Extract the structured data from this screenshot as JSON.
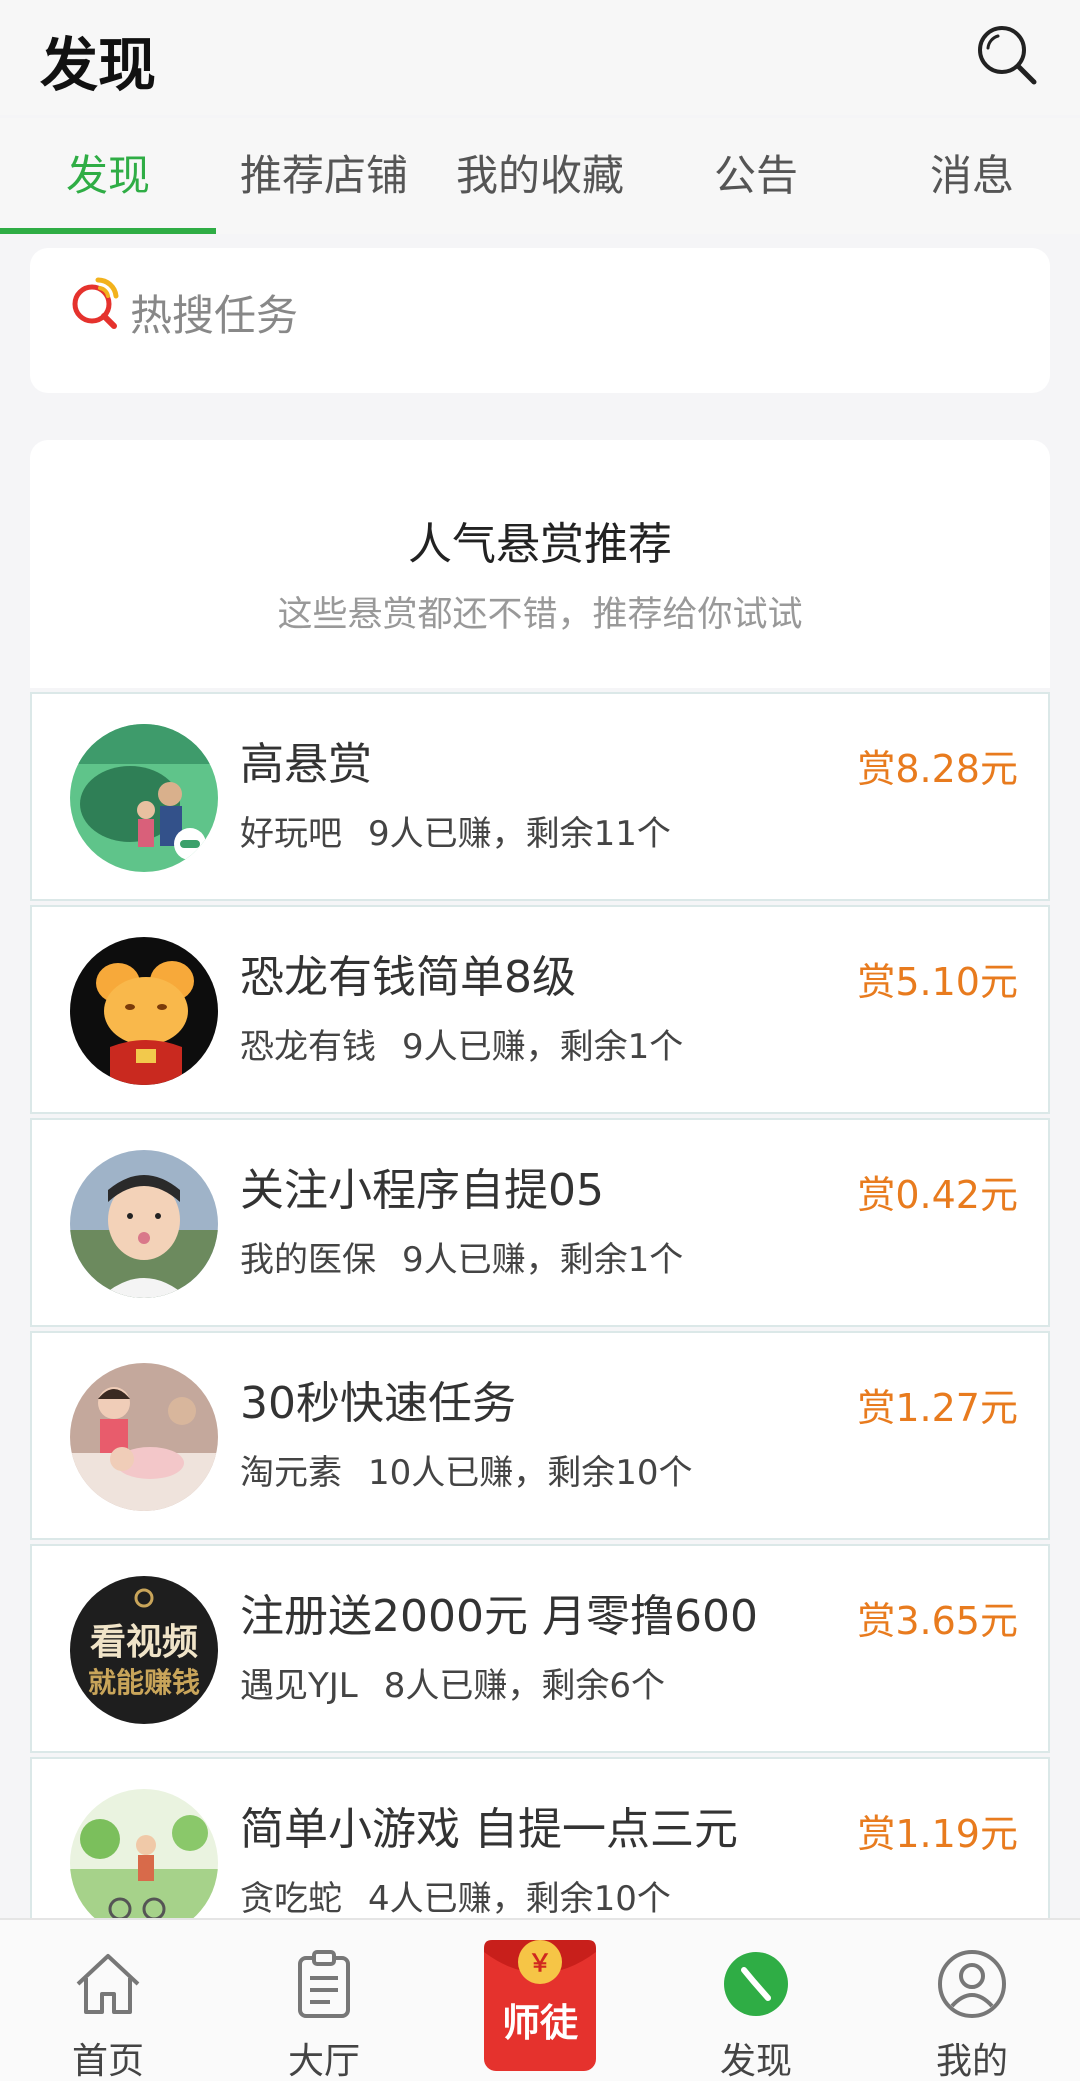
{
  "header": {
    "title": "发现"
  },
  "tabs": [
    {
      "label": "发现",
      "active": true
    },
    {
      "label": "推荐店铺"
    },
    {
      "label": "我的收藏"
    },
    {
      "label": "公告"
    },
    {
      "label": "消息"
    }
  ],
  "hot_search": {
    "label": "热搜任务"
  },
  "recommend": {
    "title": "人气悬赏推荐",
    "subtitle": "这些悬赏都还不错，推荐给你试试"
  },
  "tasks": [
    {
      "name": "高悬赏",
      "shop": "好玩吧",
      "stats": "9人已赚，剩余11个",
      "reward": "赏8.28元",
      "avatar_color": "#4fbf7a"
    },
    {
      "name": "恐龙有钱简单8级",
      "shop": "恐龙有钱",
      "stats": "9人已赚，剩余1个",
      "reward": "赏5.10元",
      "avatar_color": "#111111"
    },
    {
      "name": "关注小程序自提05",
      "shop": "我的医保",
      "stats": "9人已赚，剩余1个",
      "reward": "赏0.42元",
      "avatar_color": "#8aa0b8"
    },
    {
      "name": "30秒快速任务",
      "shop": "淘元素",
      "stats": "10人已赚，剩余10个",
      "reward": "赏1.27元",
      "avatar_color": "#c7a79a"
    },
    {
      "name": "注册送2000元 月零撸600",
      "shop": "遇见YJL",
      "stats": "8人已赚，剩余6个",
      "reward": "赏3.65元",
      "avatar_color": "#2b2b2b"
    },
    {
      "name": "简单小游戏  自提一点三元",
      "shop": "贪吃蛇",
      "stats": "4人已赚，剩余10个",
      "reward": "赏1.19元",
      "avatar_color": "#a6d28a"
    }
  ],
  "avatar_texts": {
    "task5_line1": "看视频",
    "task5_line2": "就能赚钱"
  },
  "bottom_nav": [
    {
      "label": "首页",
      "icon": "home-icon"
    },
    {
      "label": "大厅",
      "icon": "clipboard-icon"
    },
    {
      "label": "师徒",
      "icon": "red-envelope-icon"
    },
    {
      "label": "发现",
      "icon": "compass-icon",
      "active": true
    },
    {
      "label": "我的",
      "icon": "user-icon"
    }
  ],
  "colors": {
    "accent": "#2fad45",
    "reward": "#e87b1e",
    "envelope": "#e5322d"
  }
}
